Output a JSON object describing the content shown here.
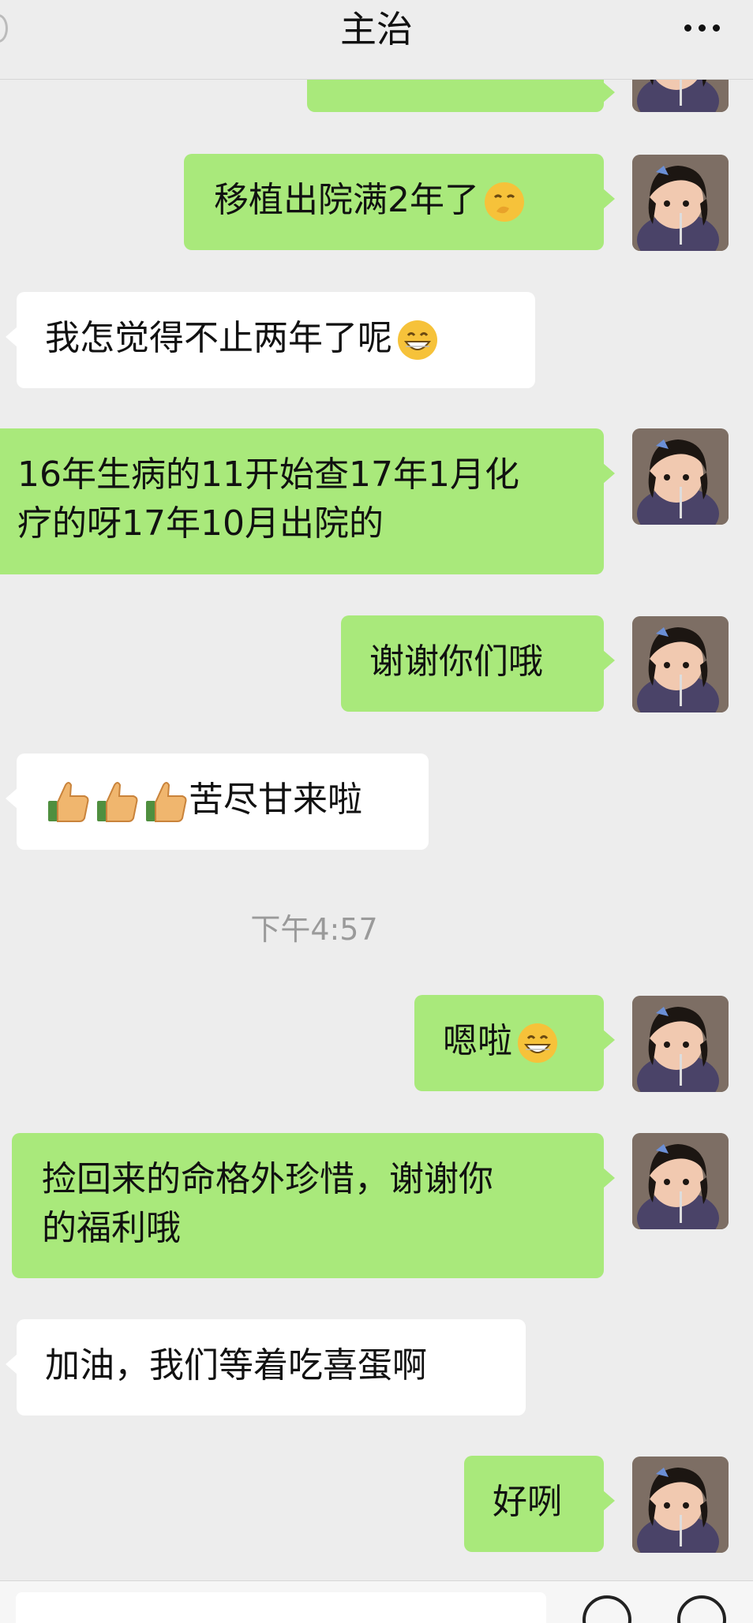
{
  "header": {
    "title": "主治",
    "more_icon": "more-icon"
  },
  "colors": {
    "background": "#ededed",
    "outgoing_bubble": "#a9e97b",
    "incoming_bubble": "#ffffff",
    "timestamp_text": "#9a9a9a"
  },
  "messages": [
    {
      "id": "m0",
      "direction": "out",
      "text": "",
      "emoji": "smile-emoji",
      "note": "partially-scrolled-out"
    },
    {
      "id": "m1",
      "direction": "out",
      "text": "移植出院满2年了",
      "emoji": "hush-emoji"
    },
    {
      "id": "m2",
      "direction": "in",
      "text": "我怎觉得不止两年了呢",
      "emoji": "grin-emoji"
    },
    {
      "id": "m3",
      "direction": "out",
      "lines": [
        "16年生病的11开始查17年1月化",
        "疗的呀17年10月出院的"
      ]
    },
    {
      "id": "m4",
      "direction": "out",
      "text": "谢谢你们哦"
    },
    {
      "id": "m5",
      "direction": "in",
      "text": "苦尽甘来啦",
      "prefix_emojis": [
        "thumbs-up-emoji",
        "thumbs-up-emoji",
        "thumbs-up-emoji"
      ]
    },
    {
      "id": "m6",
      "direction": "out",
      "text": "嗯啦",
      "emoji": "grin-emoji"
    },
    {
      "id": "m7",
      "direction": "out",
      "lines": [
        "捡回来的命格外珍惜，谢谢你",
        "的福利哦"
      ]
    },
    {
      "id": "m8",
      "direction": "in",
      "text": "加油，我们等着吃喜蛋啊"
    },
    {
      "id": "m9",
      "direction": "out",
      "text": "好咧"
    }
  ],
  "timestamp": "下午4:57",
  "avatar_icon": "child-avatar-icon"
}
